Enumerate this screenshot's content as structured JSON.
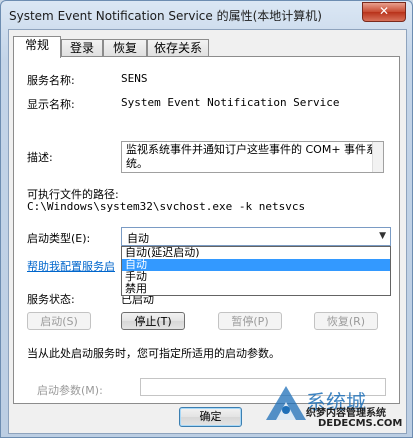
{
  "window": {
    "title": "System Event Notification Service 的属性(本地计算机)",
    "close_label": "✕"
  },
  "tabs": [
    {
      "label": "常规"
    },
    {
      "label": "登录"
    },
    {
      "label": "恢复"
    },
    {
      "label": "依存关系"
    }
  ],
  "general": {
    "service_name_label": "服务名称:",
    "service_name_value": "SENS",
    "display_name_label": "显示名称:",
    "display_name_value": "System Event Notification Service",
    "description_label": "描述:",
    "description_value": "监视系统事件并通知订户这些事件的 COM+ 事件系统。",
    "exe_path_label": "可执行文件的路径:",
    "exe_path_value": "C:\\Windows\\system32\\svchost.exe -k netsvcs",
    "startup_type_label": "启动类型(E):",
    "startup_type_value": "自动",
    "startup_options": [
      "自动(延迟启动)",
      "自动",
      "手动",
      "禁用"
    ],
    "help_link": "帮助我配置服务启",
    "status_label": "服务状态:",
    "status_value": "已启动",
    "start_button": "启动(S)",
    "stop_button": "停止(T)",
    "pause_button": "暂停(P)",
    "resume_button": "恢复(R)",
    "hint": "当从此处启动服务时，您可指定所适用的启动参数。",
    "start_params_label": "启动参数(M):",
    "start_params_value": ""
  },
  "footer": {
    "ok_button": "确定"
  },
  "watermark": {
    "line1": "系统城",
    "line2": "织梦内容管理系统",
    "line3": "DEDECMS.COM"
  },
  "colors": {
    "link": "#0066cc",
    "highlight": "#3399ff",
    "close_button": "#c74a31"
  }
}
